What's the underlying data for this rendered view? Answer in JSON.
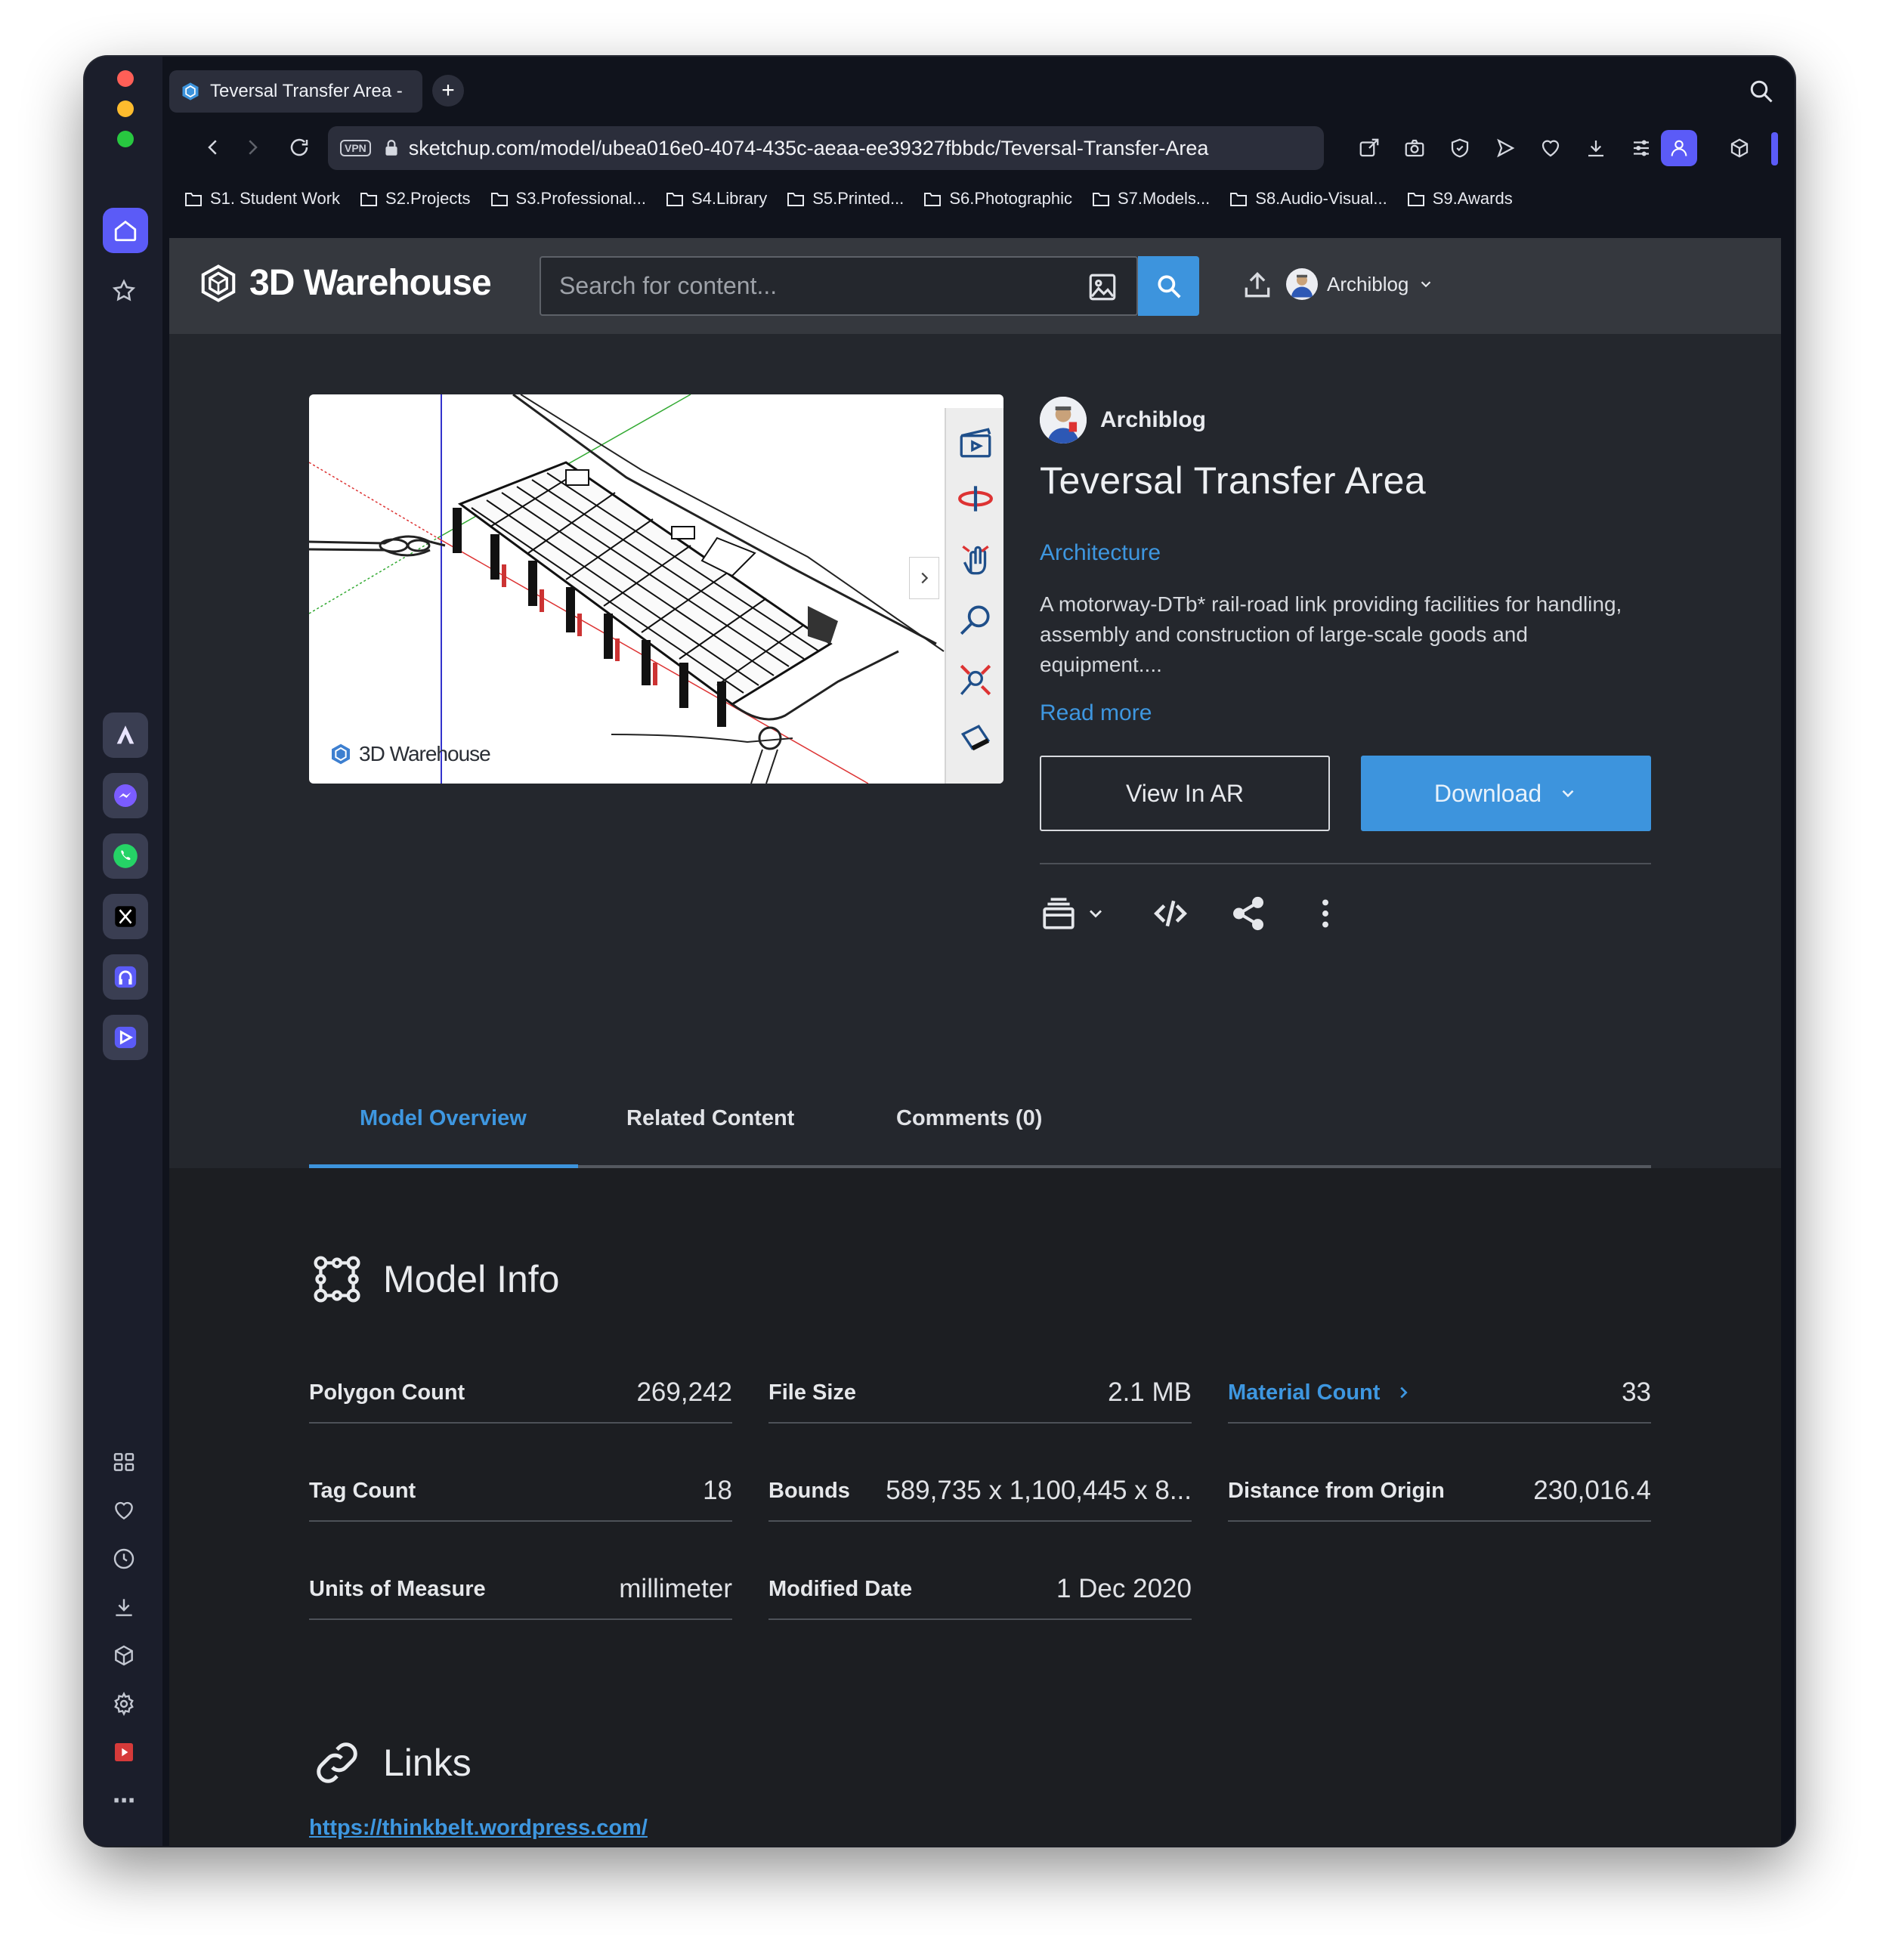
{
  "browser": {
    "tab_title": "Teversal Transfer Area -",
    "new_tab": "+",
    "url": "sketchup.com/model/ubea016e0-4074-435c-aeaa-ee39327fbbdc/Teversal-Transfer-Area",
    "vpn_badge": "VPN",
    "bookmarks": [
      "S1. Student Work",
      "S2.Projects",
      "S3.Professional...",
      "S4.Library",
      "S5.Printed...",
      "S6.Photographic",
      "S7.Models...",
      "S8.Audio-Visual...",
      "S9.Awards"
    ],
    "traffic_colors": {
      "close": "#ff5f57",
      "minimize": "#febc2e",
      "zoom": "#28c840"
    },
    "accent": "#5b5bf7"
  },
  "site": {
    "logo_text": "3D Warehouse",
    "search_placeholder": "Search for content...",
    "user_name": "Archiblog"
  },
  "viewer": {
    "watermark": "3D Warehouse"
  },
  "model": {
    "author": "Archiblog",
    "title": "Teversal Transfer Area",
    "category": "Architecture",
    "description": "A motorway-DTb* rail-road link providing facilities for handling, assembly and construction of large-scale goods and equipment....",
    "read_more": "Read more",
    "view_ar": "View In AR",
    "download": "Download"
  },
  "tabs": [
    "Model Overview",
    "Related Content",
    "Comments (0)"
  ],
  "model_info": {
    "heading": "Model Info",
    "rows": [
      {
        "label": "Polygon Count",
        "value": "269,242"
      },
      {
        "label": "File Size",
        "value": "2.1 MB"
      },
      {
        "label": "Material Count",
        "value": "33"
      },
      {
        "label": "Tag Count",
        "value": "18"
      },
      {
        "label": "Bounds",
        "value": "589,735 x 1,100,445 x 8..."
      },
      {
        "label": "Distance from Origin",
        "value": "230,016.4"
      },
      {
        "label": "Units of Measure",
        "value": "millimeter"
      },
      {
        "label": "Modified Date",
        "value": "1 Dec 2020"
      }
    ]
  },
  "links": {
    "heading": "Links",
    "items": [
      "https://thinkbelt.wordpress.com/"
    ]
  },
  "colors": {
    "accent_blue": "#3d94dd",
    "header_bg": "#35383e",
    "page_bg": "#24272d"
  }
}
